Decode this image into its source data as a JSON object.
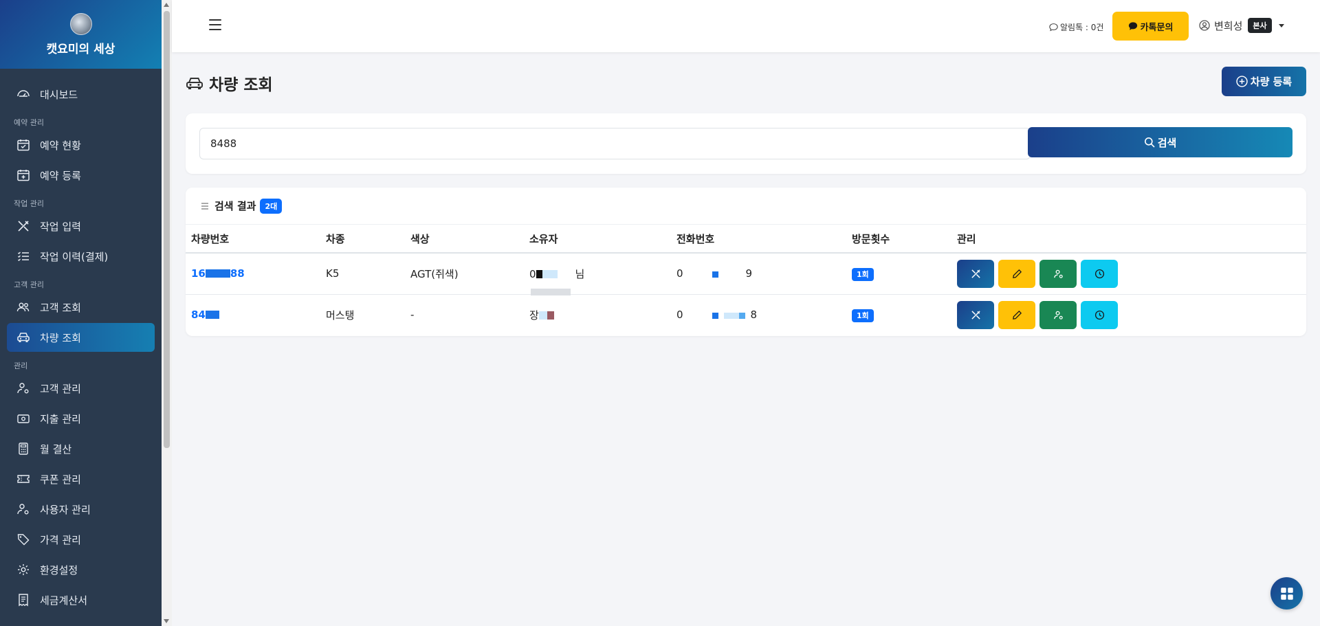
{
  "brand": {
    "title": "캣요미의 세상"
  },
  "sidebar": {
    "items": [
      {
        "type": "item",
        "label": "대시보드",
        "icon": "dashboard-icon"
      },
      {
        "type": "section",
        "label": "예약 관리"
      },
      {
        "type": "item",
        "label": "예약 현황",
        "icon": "calendar-check-icon"
      },
      {
        "type": "item",
        "label": "예약 등록",
        "icon": "calendar-plus-icon"
      },
      {
        "type": "section",
        "label": "작업 관리"
      },
      {
        "type": "item",
        "label": "작업 입력",
        "icon": "tools-icon"
      },
      {
        "type": "item",
        "label": "작업 이력(결제)",
        "icon": "list-check-icon"
      },
      {
        "type": "section",
        "label": "고객 관리"
      },
      {
        "type": "item",
        "label": "고객 조회",
        "icon": "people-icon"
      },
      {
        "type": "item",
        "label": "차량 조회",
        "icon": "car-icon",
        "active": true
      },
      {
        "type": "section",
        "label": "관리"
      },
      {
        "type": "item",
        "label": "고객 관리",
        "icon": "person-gear-icon"
      },
      {
        "type": "item",
        "label": "지출 관리",
        "icon": "cash-icon"
      },
      {
        "type": "item",
        "label": "월 결산",
        "icon": "calculator-icon"
      },
      {
        "type": "item",
        "label": "쿠폰 관리",
        "icon": "ticket-icon"
      },
      {
        "type": "item",
        "label": "사용자 관리",
        "icon": "person-gear-icon"
      },
      {
        "type": "item",
        "label": "가격 관리",
        "icon": "tags-icon"
      },
      {
        "type": "item",
        "label": "환경설정",
        "icon": "gear-icon"
      },
      {
        "type": "item",
        "label": "세금계산서",
        "icon": "receipt-icon"
      }
    ]
  },
  "topbar": {
    "alert_text": "알림톡 : 0건",
    "kakao_label": "카톡문의",
    "user_name": "변희성",
    "branch_badge": "본사"
  },
  "page": {
    "title": "차량 조회",
    "register_label": "차량 등록"
  },
  "search": {
    "value": "8488",
    "button_label": "검색"
  },
  "results": {
    "title": "검색 결과",
    "count": "2대",
    "columns": [
      "차량번호",
      "차종",
      "색상",
      "소유자",
      "전화번호",
      "방문횟수",
      "관리"
    ],
    "rows": [
      {
        "plate_prefix": "16",
        "plate_suffix": "88",
        "model": "K5",
        "color": "AGT(쥐색)",
        "owner_prefix": "0",
        "owner_suffix": "님",
        "phone_prefix": "0",
        "phone_suffix": "9",
        "visits": "1회"
      },
      {
        "plate_prefix": "84",
        "plate_suffix": "",
        "model": "머스탱",
        "color": "-",
        "owner_prefix": "장",
        "owner_suffix": "",
        "phone_prefix": "0",
        "phone_suffix": "8",
        "visits": "1회"
      }
    ]
  },
  "colors": {
    "accent": "#1b3f8a",
    "accent_light": "#1689b6",
    "sidebar_bg": "#2a3a4e",
    "kakao": "#ffc107",
    "success": "#198754",
    "info": "#0dcaf0",
    "primary": "#0d6efd"
  }
}
